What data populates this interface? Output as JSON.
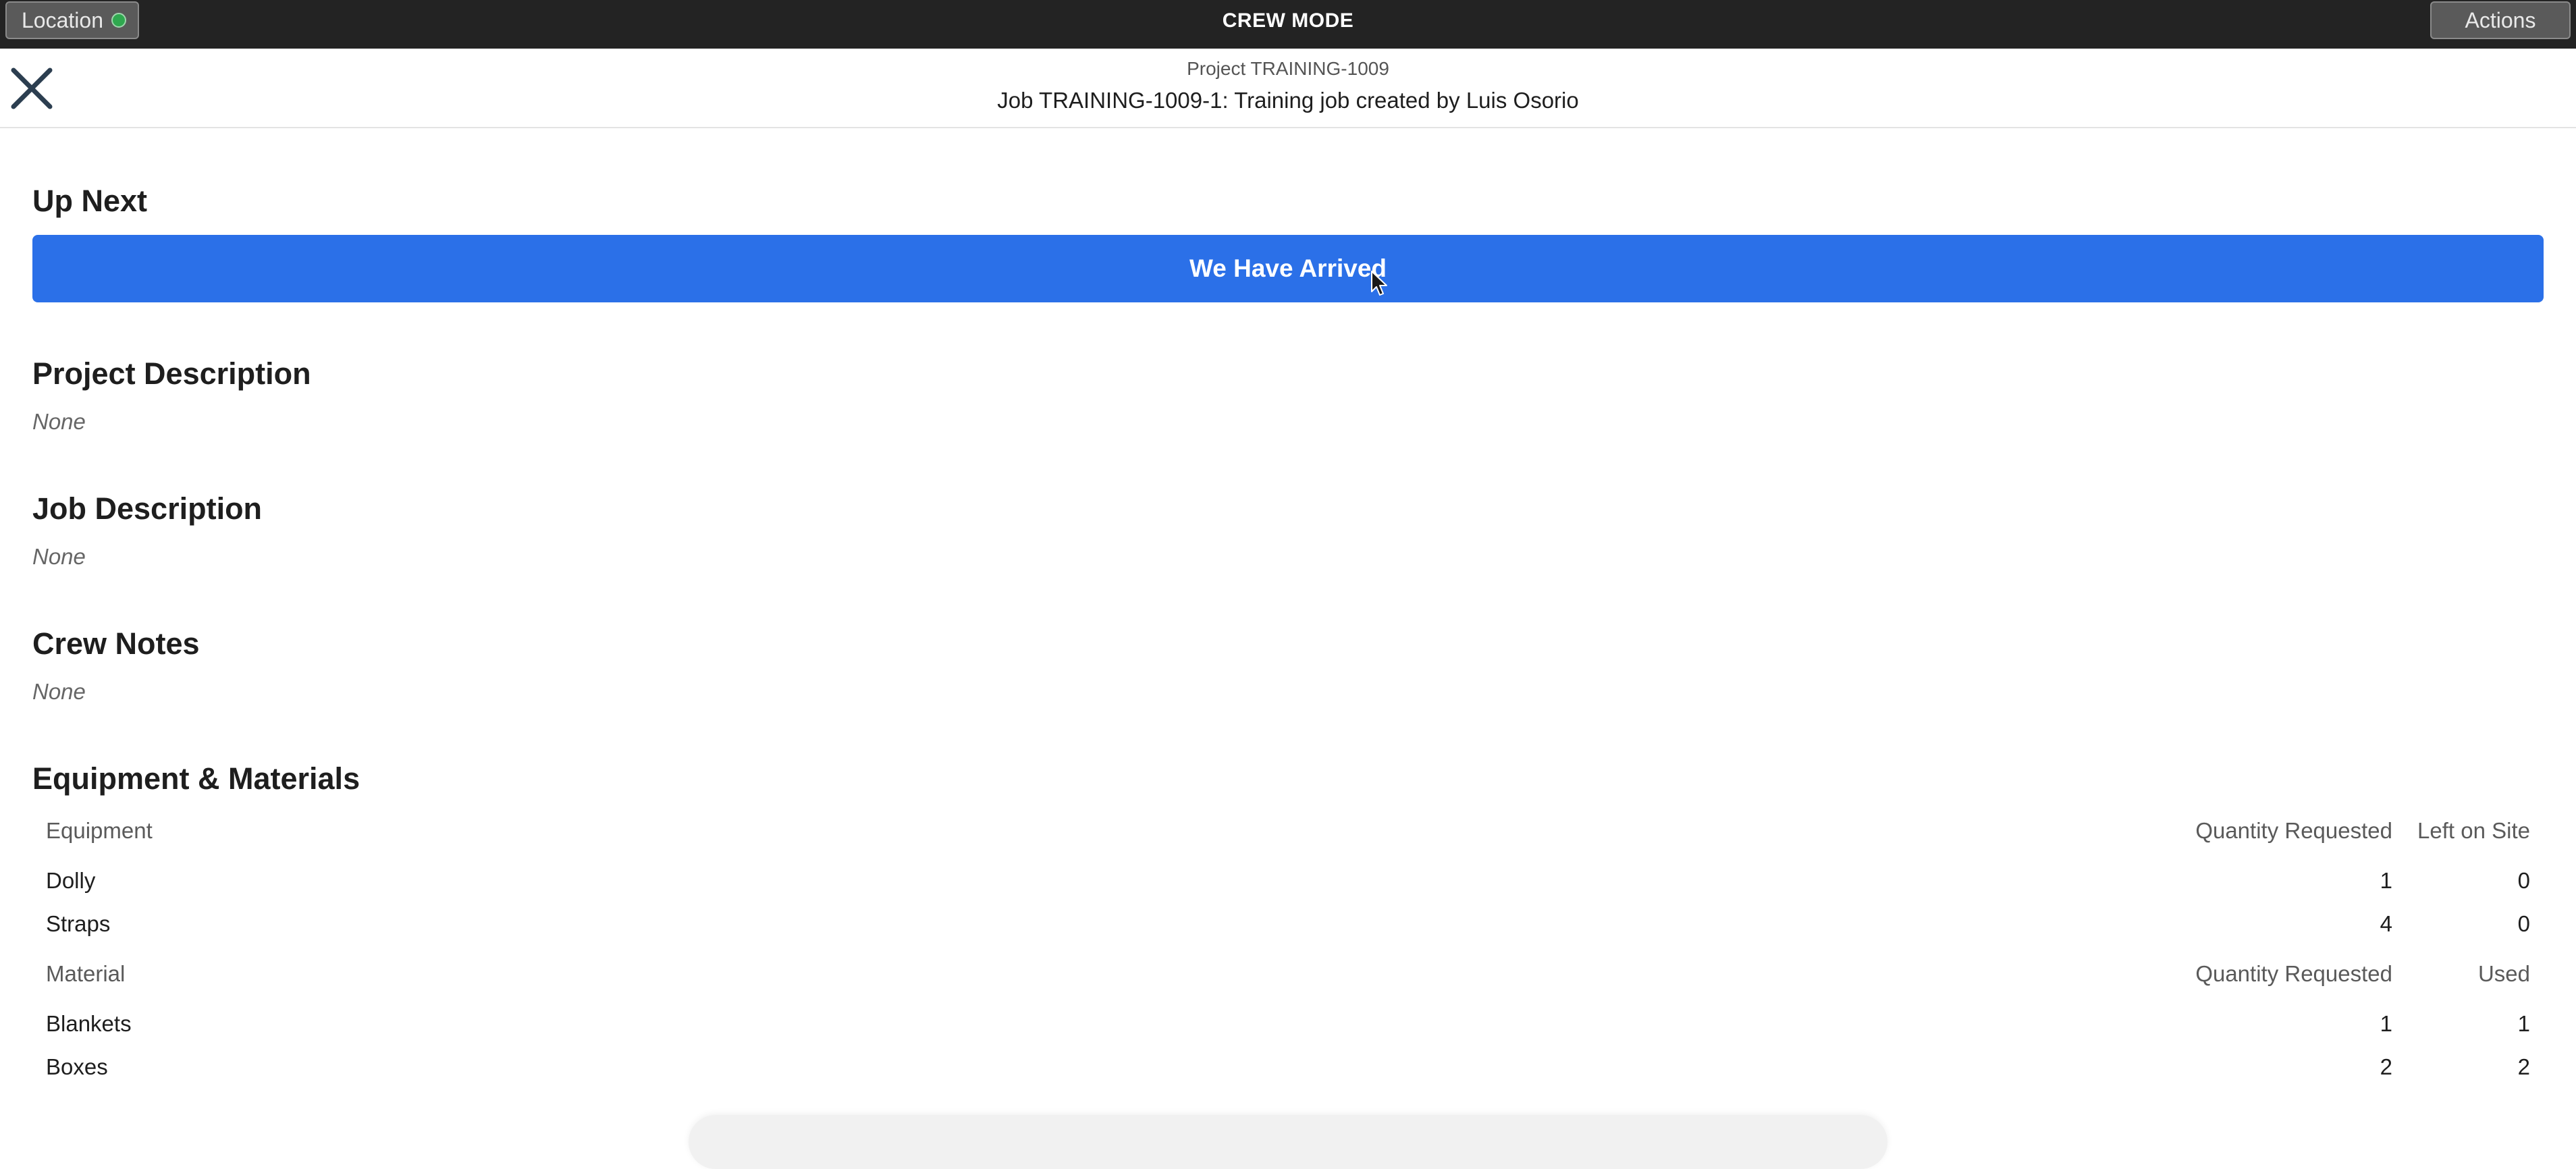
{
  "topbar": {
    "location_label": "Location",
    "location_status_color": "#2fa84f",
    "mode_title": "CREW MODE",
    "actions_label": "Actions"
  },
  "header": {
    "close_icon": "close-icon",
    "project": "Project TRAINING-1009",
    "job": "Job TRAINING-1009-1: Training job created by Luis Osorio"
  },
  "up_next": {
    "title": "Up Next",
    "button_label": "We Have Arrived",
    "button_color": "#2b70e8"
  },
  "project_description": {
    "title": "Project Description",
    "value": "None"
  },
  "job_description": {
    "title": "Job Description",
    "value": "None"
  },
  "crew_notes": {
    "title": "Crew Notes",
    "value": "None"
  },
  "equipment_materials": {
    "title": "Equipment & Materials",
    "equipment": {
      "headers": [
        "Equipment",
        "Quantity Requested",
        "Left on Site"
      ],
      "rows": [
        {
          "name": "Dolly",
          "qty": "1",
          "last": "0"
        },
        {
          "name": "Straps",
          "qty": "4",
          "last": "0"
        }
      ]
    },
    "material": {
      "headers": [
        "Material",
        "Quantity Requested",
        "Used"
      ],
      "rows": [
        {
          "name": "Blankets",
          "qty": "1",
          "last": "1"
        },
        {
          "name": "Boxes",
          "qty": "2",
          "last": "2"
        }
      ]
    }
  }
}
